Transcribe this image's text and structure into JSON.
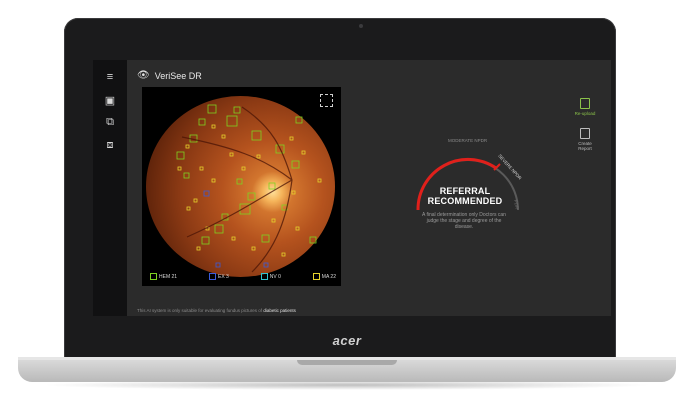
{
  "app": {
    "title": "VeriSee DR",
    "brand_logo": "acer"
  },
  "nav": [
    {
      "icon": "menu-icon",
      "glyph": "≡"
    },
    {
      "icon": "image-icon",
      "glyph": "▣"
    },
    {
      "icon": "compare-icon",
      "glyph": "⧉"
    },
    {
      "icon": "history-icon",
      "glyph": "⧈"
    }
  ],
  "fundus": {
    "legend": [
      {
        "label": "HEM 21",
        "color": "#7ed321"
      },
      {
        "label": "EX 3",
        "color": "#3a5bd9"
      },
      {
        "label": "NV 0",
        "color": "#2ec4d0"
      },
      {
        "label": "MA 22",
        "color": "#e5d22c"
      }
    ]
  },
  "result": {
    "status_line1": "REFERRAL",
    "status_line2": "RECOMMENDED",
    "arc_label_left": "MODERATE NPDR",
    "arc_label_right": "SEVERE NPDR",
    "arc_label_far": "PDR",
    "note": "A final determination only Doctors can judge the stage and degree of the disease.",
    "accent": "#e0201b"
  },
  "tools": [
    {
      "label": "Re-upload",
      "icon": "upload-icon",
      "color": "#8bc34a"
    },
    {
      "label": "Create Report",
      "icon": "report-icon",
      "color": "#bdbdbd"
    }
  ],
  "disclaimer": {
    "text": "This AI system is only suitable for evaluating fundus pictures of",
    "highlight": "diabetic patients"
  }
}
